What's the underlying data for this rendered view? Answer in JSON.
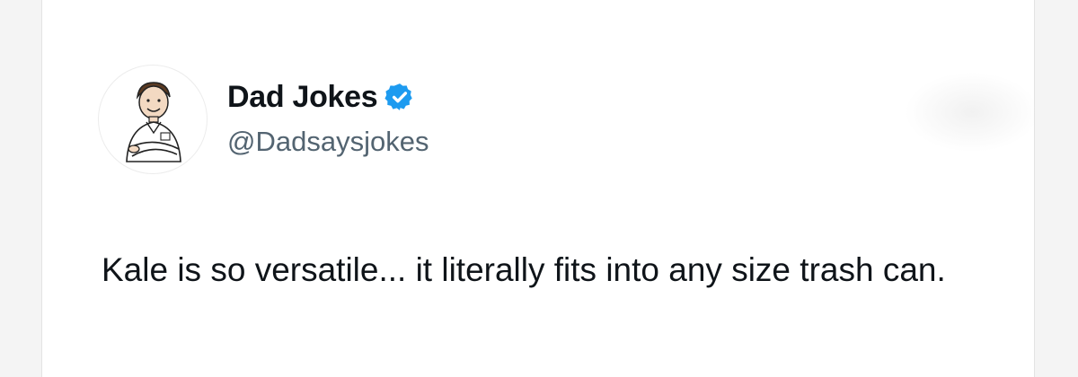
{
  "tweet": {
    "display_name": "Dad Jokes",
    "handle": "@Dadsaysjokes",
    "text": "Kale is so versatile... it literally fits into any size trash can.",
    "verified": true,
    "verified_color": "#1d9bf0"
  },
  "icons": {
    "avatar": "cartoon-dad-avatar",
    "verified": "verified-badge-icon"
  }
}
